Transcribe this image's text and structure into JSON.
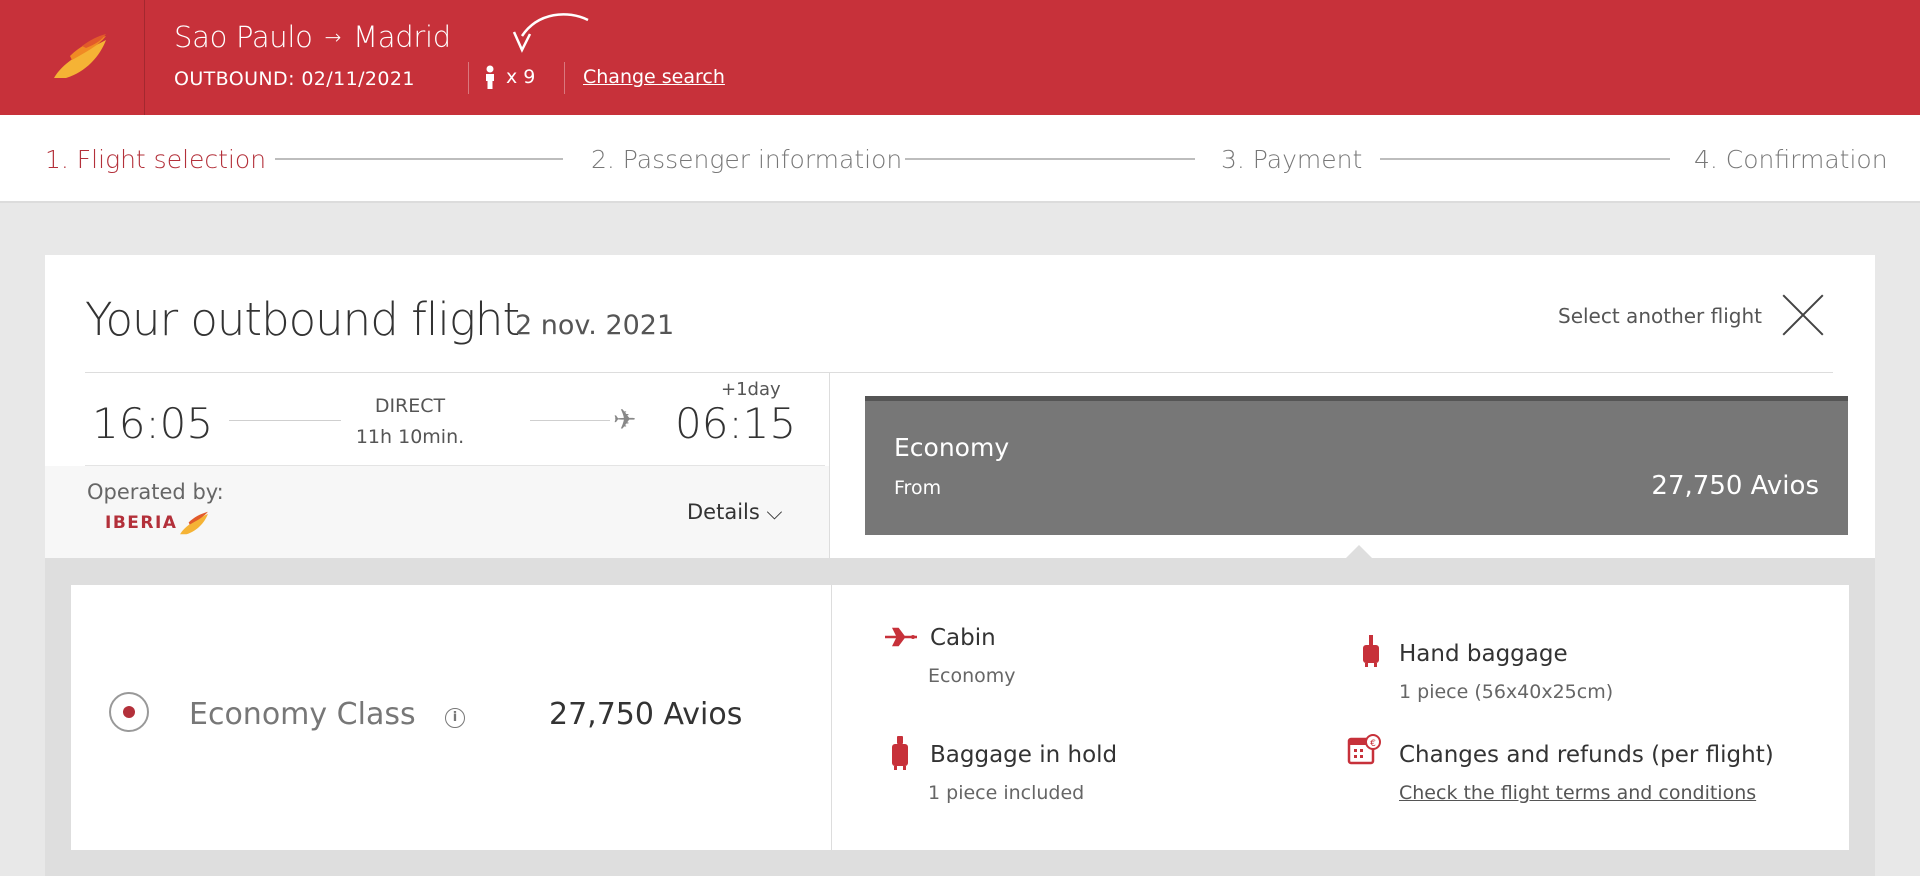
{
  "header": {
    "origin": "Sao Paulo",
    "destination": "Madrid",
    "route_arrow": "→",
    "outbound_label": "OUTBOUND: 02/11/2021",
    "passengers": "x 9",
    "change_search": "Change search",
    "brand_color": "#c7313a"
  },
  "steps": [
    {
      "label": "1. Flight selection",
      "active": true
    },
    {
      "label": "2. Passenger information",
      "active": false
    },
    {
      "label": "3. Payment",
      "active": false
    },
    {
      "label": "4. Confirmation",
      "active": false
    }
  ],
  "flight": {
    "title": "Your outbound flight",
    "date": "2 nov. 2021",
    "select_another": "Select another flight",
    "departure_time": "16:05",
    "arrival_time": "06:15",
    "plus_day": "+1day",
    "stops": "DIRECT",
    "duration": "11h 10min.",
    "operated_by_label": "Operated by:",
    "operator": "IBERIA",
    "details_label": "Details ⌵"
  },
  "fare": {
    "name": "Economy",
    "from_label": "From",
    "price": "27,750 Avios"
  },
  "option": {
    "class_name": "Economy Class",
    "info_icon": "i",
    "price": "27,750 Avios"
  },
  "features": {
    "cabin": {
      "title": "Cabin",
      "value": "Economy",
      "icon": "plane-icon"
    },
    "hand_baggage": {
      "title": "Hand baggage",
      "value": "1 piece (56x40x25cm)",
      "icon": "suitcase-icon"
    },
    "hold_baggage": {
      "title": "Baggage in hold",
      "value": "1 piece included",
      "icon": "luggage-icon"
    },
    "changes": {
      "title": "Changes and refunds (per flight)",
      "link": "Check the flight terms and conditions",
      "icon": "calendar-euro-icon"
    }
  }
}
